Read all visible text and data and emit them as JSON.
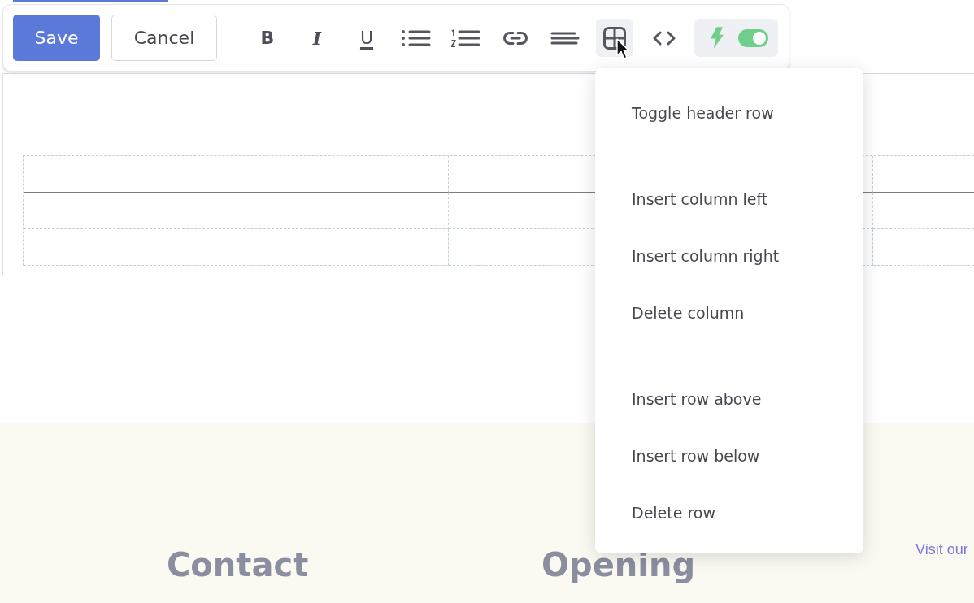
{
  "toolbar": {
    "buttons": [
      {
        "kind": "primary",
        "label": "Save"
      },
      {
        "kind": "secondary",
        "label": "Cancel"
      }
    ],
    "tools": [
      {
        "kind": "bold",
        "label": "B",
        "active": false
      },
      {
        "kind": "italic",
        "label": "I",
        "active": false
      },
      {
        "kind": "underline",
        "label": "U",
        "active": false
      },
      {
        "kind": "bullet-list",
        "active": false
      },
      {
        "kind": "numbered-list",
        "active": false
      },
      {
        "kind": "link",
        "active": false
      },
      {
        "kind": "align",
        "active": false
      },
      {
        "kind": "table",
        "active": true
      },
      {
        "kind": "code",
        "active": false
      }
    ],
    "toggle": {
      "on": true
    }
  },
  "editor": {
    "table": {
      "header_row": true
    }
  },
  "table_menu": {
    "groups": [
      {
        "items": [
          "Toggle header row"
        ]
      },
      {
        "items": [
          "Insert column left",
          "Insert column right",
          "Delete column"
        ]
      },
      {
        "items": [
          "Insert row above",
          "Insert row below",
          "Delete row"
        ]
      }
    ]
  },
  "footer": {
    "headings": [
      "Contact",
      "Opening"
    ],
    "link": "Visit our"
  }
}
